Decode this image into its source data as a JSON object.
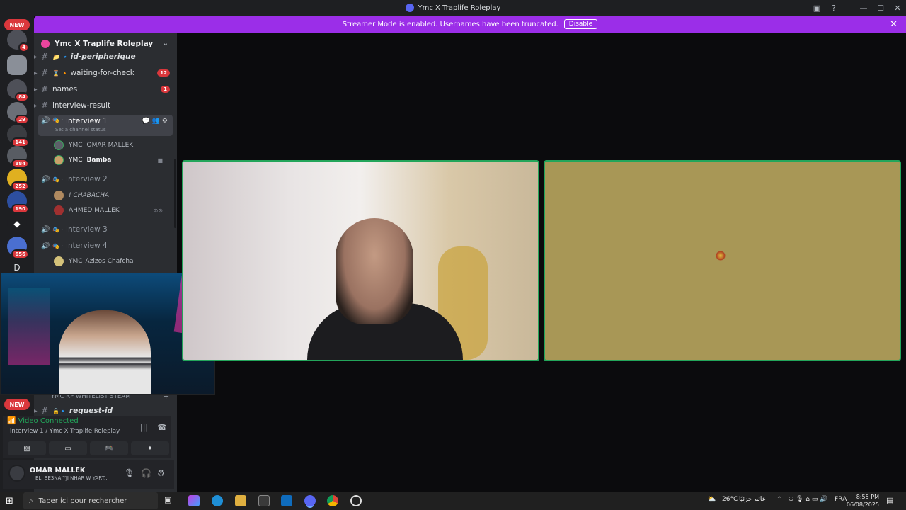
{
  "window": {
    "title": "Ymc X Traplife Roleplay"
  },
  "banner": {
    "text": "Streamer Mode is enabled. Usernames have been truncated.",
    "button": "Disable"
  },
  "rail": {
    "new_top": "NEW",
    "new_bottom": "NEW",
    "badges": [
      "4",
      "84",
      "29",
      "141",
      "884",
      "252",
      "190",
      "656"
    ],
    "dm_letter": "D"
  },
  "guild": {
    "name": "Ymc X Traplife Roleplay"
  },
  "channels": [
    {
      "name": "id-peripherique",
      "prefix": "📁 🔹"
    },
    {
      "name": "waiting-for-check",
      "prefix": "⌛ 🔸",
      "badge": "12"
    },
    {
      "name": "names",
      "badge": "1"
    },
    {
      "name": "interview-result"
    }
  ],
  "voice": {
    "interview1": {
      "name": "interview 1",
      "status": "Set a channel status"
    },
    "interview1_users": [
      {
        "tag": "YMC",
        "name": "OMAR MALLEK"
      },
      {
        "tag": "YMC",
        "name": "Bamba"
      }
    ],
    "interview2": {
      "name": "interview 2"
    },
    "interview2_users": [
      {
        "name": "! CHABACHA"
      },
      {
        "name": "AHMED MALLEK"
      }
    ],
    "interview3": {
      "name": "interview 3"
    },
    "interview4": {
      "name": "interview 4"
    },
    "interview4_users": [
      {
        "tag": "YMC",
        "name": "Azizos Chafcha"
      }
    ]
  },
  "category": {
    "name": "YMC RP WHITELIST STEAM"
  },
  "request_channel": {
    "name": "request-id"
  },
  "connection": {
    "title": "Video Connected",
    "location": "interview 1 / Ymc X Traplife Roleplay"
  },
  "user": {
    "name": "OMAR MALLEK",
    "status": "ELI BE3NA YJI NHAR W YART..."
  },
  "taskbar": {
    "search_placeholder": "Taper ici pour rechercher",
    "weather": "26°C",
    "weather_text": "غائم جزئيًا",
    "lang": "FRA",
    "time": "8:55 PM",
    "date": "06/08/2025"
  },
  "colors": {
    "accent": "#5865f2",
    "banner": "#9b2ee8",
    "online": "#23a55a",
    "badge": "#da373c"
  }
}
